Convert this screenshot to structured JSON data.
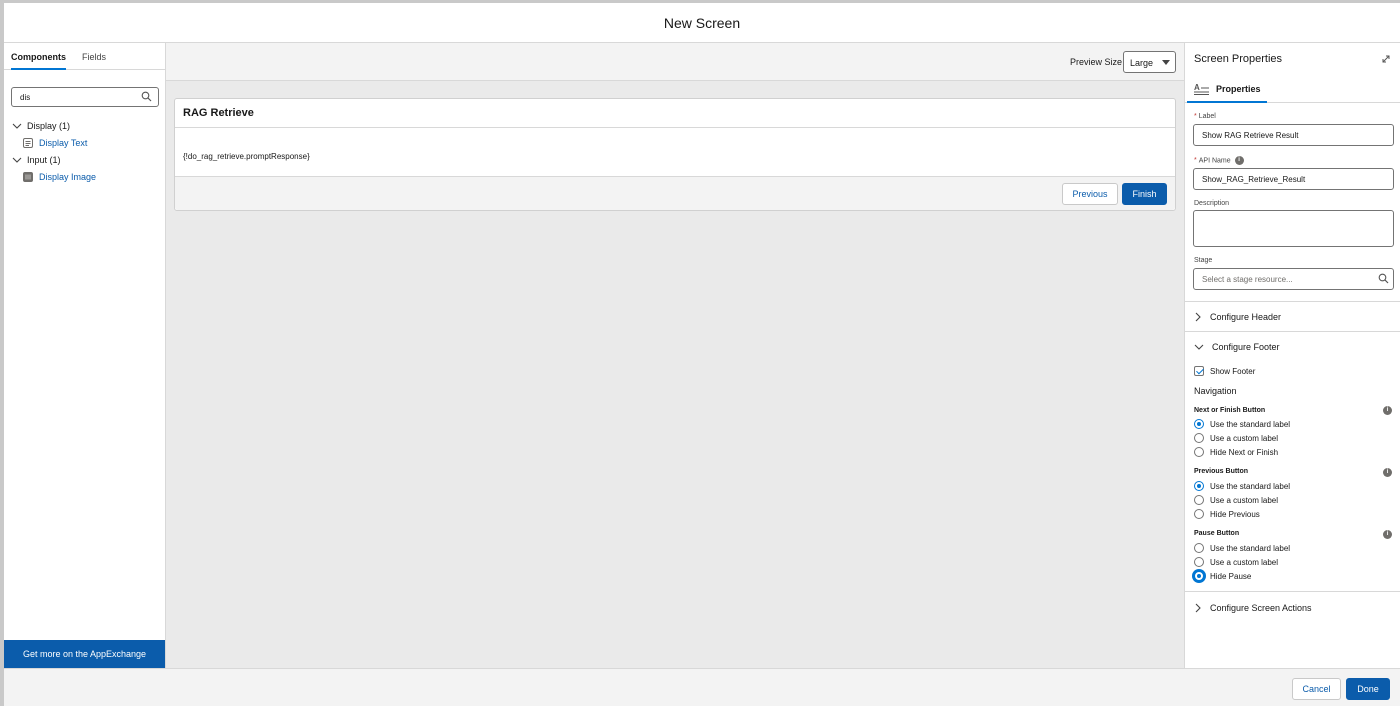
{
  "modal": {
    "title": "New Screen"
  },
  "left_panel": {
    "tabs": [
      {
        "label": "Components"
      },
      {
        "label": "Fields"
      }
    ],
    "search_value": "dis",
    "groups": [
      {
        "label": "Display (1)",
        "items": [
          {
            "label": "Display Text"
          }
        ]
      },
      {
        "label": "Input (1)",
        "items": [
          {
            "label": "Display Image"
          }
        ]
      }
    ],
    "appexchange_label": "Get more on the AppExchange"
  },
  "canvas": {
    "preview_size_label": "Preview Size",
    "preview_size_value": "Large",
    "screen": {
      "title": "RAG Retrieve",
      "body_text": "{!do_rag_retrieve.promptResponse}",
      "previous_label": "Previous",
      "finish_label": "Finish"
    }
  },
  "properties": {
    "title": "Screen Properties",
    "tab_label": "Properties",
    "label_field": {
      "label": "Label",
      "value": "Show RAG Retrieve Result"
    },
    "api_name_field": {
      "label": "API Name",
      "value": "Show_RAG_Retrieve_Result"
    },
    "description_field": {
      "label": "Description",
      "value": ""
    },
    "stage_field": {
      "label": "Stage",
      "placeholder": "Select a stage resource..."
    },
    "configure_header": "Configure Header",
    "configure_footer": "Configure Footer",
    "show_footer": "Show Footer",
    "navigation_heading": "Navigation",
    "next_group": {
      "label": "Next or Finish Button",
      "options": [
        "Use the standard label",
        "Use a custom label",
        "Hide Next or Finish"
      ],
      "selected": 0
    },
    "previous_group": {
      "label": "Previous Button",
      "options": [
        "Use the standard label",
        "Use a custom label",
        "Hide Previous"
      ],
      "selected": 0
    },
    "pause_group": {
      "label": "Pause Button",
      "options": [
        "Use the standard label",
        "Use a custom label",
        "Hide Pause"
      ],
      "selected": 2
    },
    "configure_screen_actions": "Configure Screen Actions"
  },
  "footer": {
    "cancel_label": "Cancel",
    "done_label": "Done"
  },
  "colors": {
    "brand": "#0b5cab",
    "accent": "#0176d3",
    "canvas_bg": "#eaeaea"
  },
  "icons": [
    "search-icon",
    "chevron-down-icon",
    "chevron-right-icon",
    "display-text-icon",
    "display-image-icon",
    "expand-icon",
    "properties-icon",
    "info-icon"
  ]
}
